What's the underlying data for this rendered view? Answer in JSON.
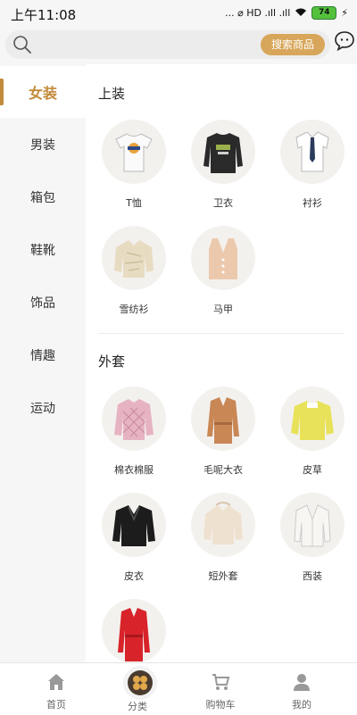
{
  "status_bar": {
    "time": "上午11:08",
    "indicators": "... ⌀ HD .ıll .ıll",
    "battery": "74"
  },
  "header": {
    "search_placeholder": "",
    "search_button": "搜索商品",
    "search_icon": "search-icon",
    "message_icon": "chat-bubble-icon"
  },
  "sidebar": {
    "items": [
      {
        "label": "女装",
        "active": true
      },
      {
        "label": "男装",
        "active": false
      },
      {
        "label": "箱包",
        "active": false
      },
      {
        "label": "鞋靴",
        "active": false
      },
      {
        "label": "饰品",
        "active": false
      },
      {
        "label": "情趣",
        "active": false
      },
      {
        "label": "运动",
        "active": false
      }
    ]
  },
  "content": {
    "sections": [
      {
        "title": "上装",
        "items": [
          {
            "label": "T恤",
            "icon": "tshirt"
          },
          {
            "label": "卫衣",
            "icon": "sweatshirt"
          },
          {
            "label": "衬衫",
            "icon": "shirt-tie"
          },
          {
            "label": "雪纺衫",
            "icon": "chiffon-blouse"
          },
          {
            "label": "马甲",
            "icon": "vest"
          }
        ]
      },
      {
        "title": "外套",
        "items": [
          {
            "label": "棉衣棉服",
            "icon": "padded-jacket"
          },
          {
            "label": "毛呢大衣",
            "icon": "wool-coat"
          },
          {
            "label": "皮草",
            "icon": "fur-coat"
          },
          {
            "label": "皮衣",
            "icon": "leather-jacket"
          },
          {
            "label": "短外套",
            "icon": "short-jacket"
          },
          {
            "label": "西装",
            "icon": "blazer"
          },
          {
            "label": "",
            "icon": "trench-coat"
          }
        ]
      }
    ]
  },
  "bottom_nav": {
    "items": [
      {
        "label": "首页",
        "icon": "home-icon"
      },
      {
        "label": "分类",
        "icon": "category-icon"
      },
      {
        "label": "购物车",
        "icon": "cart-icon"
      },
      {
        "label": "我的",
        "icon": "user-icon"
      }
    ]
  },
  "colors": {
    "accent": "#c28a3a",
    "search_button": "#d8a65a",
    "sidebar_bg": "#f6f6f6"
  }
}
